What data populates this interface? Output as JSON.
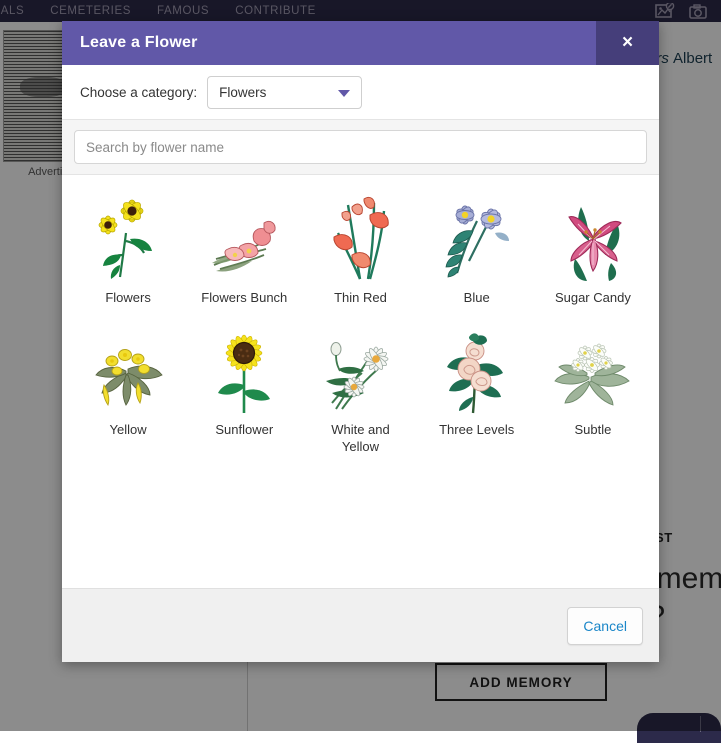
{
  "background": {
    "nav_items": [
      "RIALS",
      "CEMETERIES",
      "FAMOUS",
      "CONTRIBUTE"
    ],
    "nav_icons": [
      "image-add-icon",
      "camera-icon"
    ],
    "ad_label": "Advertise",
    "person_name_partial": "ers Albert",
    "person_name_italic": "ers",
    "section_title_partial": "ST",
    "question_line1": "emem",
    "question_line2": "t?",
    "add_memory_label": "ADD MEMORY"
  },
  "modal": {
    "title": "Leave a Flower",
    "close_label": "×",
    "category": {
      "label": "Choose a category:",
      "selected": "Flowers"
    },
    "search": {
      "value": "",
      "placeholder": "Search by flower name"
    },
    "flowers": [
      {
        "name": "Flowers",
        "art": "daisies-yellow"
      },
      {
        "name": "Flowers Bunch",
        "art": "pink-bunch"
      },
      {
        "name": "Thin Red",
        "art": "red-gladiolus"
      },
      {
        "name": "Blue",
        "art": "blue-periwinkle"
      },
      {
        "name": "Sugar Candy",
        "art": "pink-lily"
      },
      {
        "name": "Yellow",
        "art": "yellow-cluster"
      },
      {
        "name": "Sunflower",
        "art": "sunflower"
      },
      {
        "name": "White and Yellow",
        "art": "white-daisy"
      },
      {
        "name": "Three Levels",
        "art": "peach-roses"
      },
      {
        "name": "Subtle",
        "art": "white-cluster"
      }
    ],
    "footer": {
      "cancel_label": "Cancel"
    }
  },
  "colors": {
    "modal_header": "#6158a8",
    "modal_close_bg": "#453e7a",
    "topnav": "#2c2a4a",
    "cancel_text": "#1a86c8",
    "footer_bg": "#f0f0f0"
  }
}
